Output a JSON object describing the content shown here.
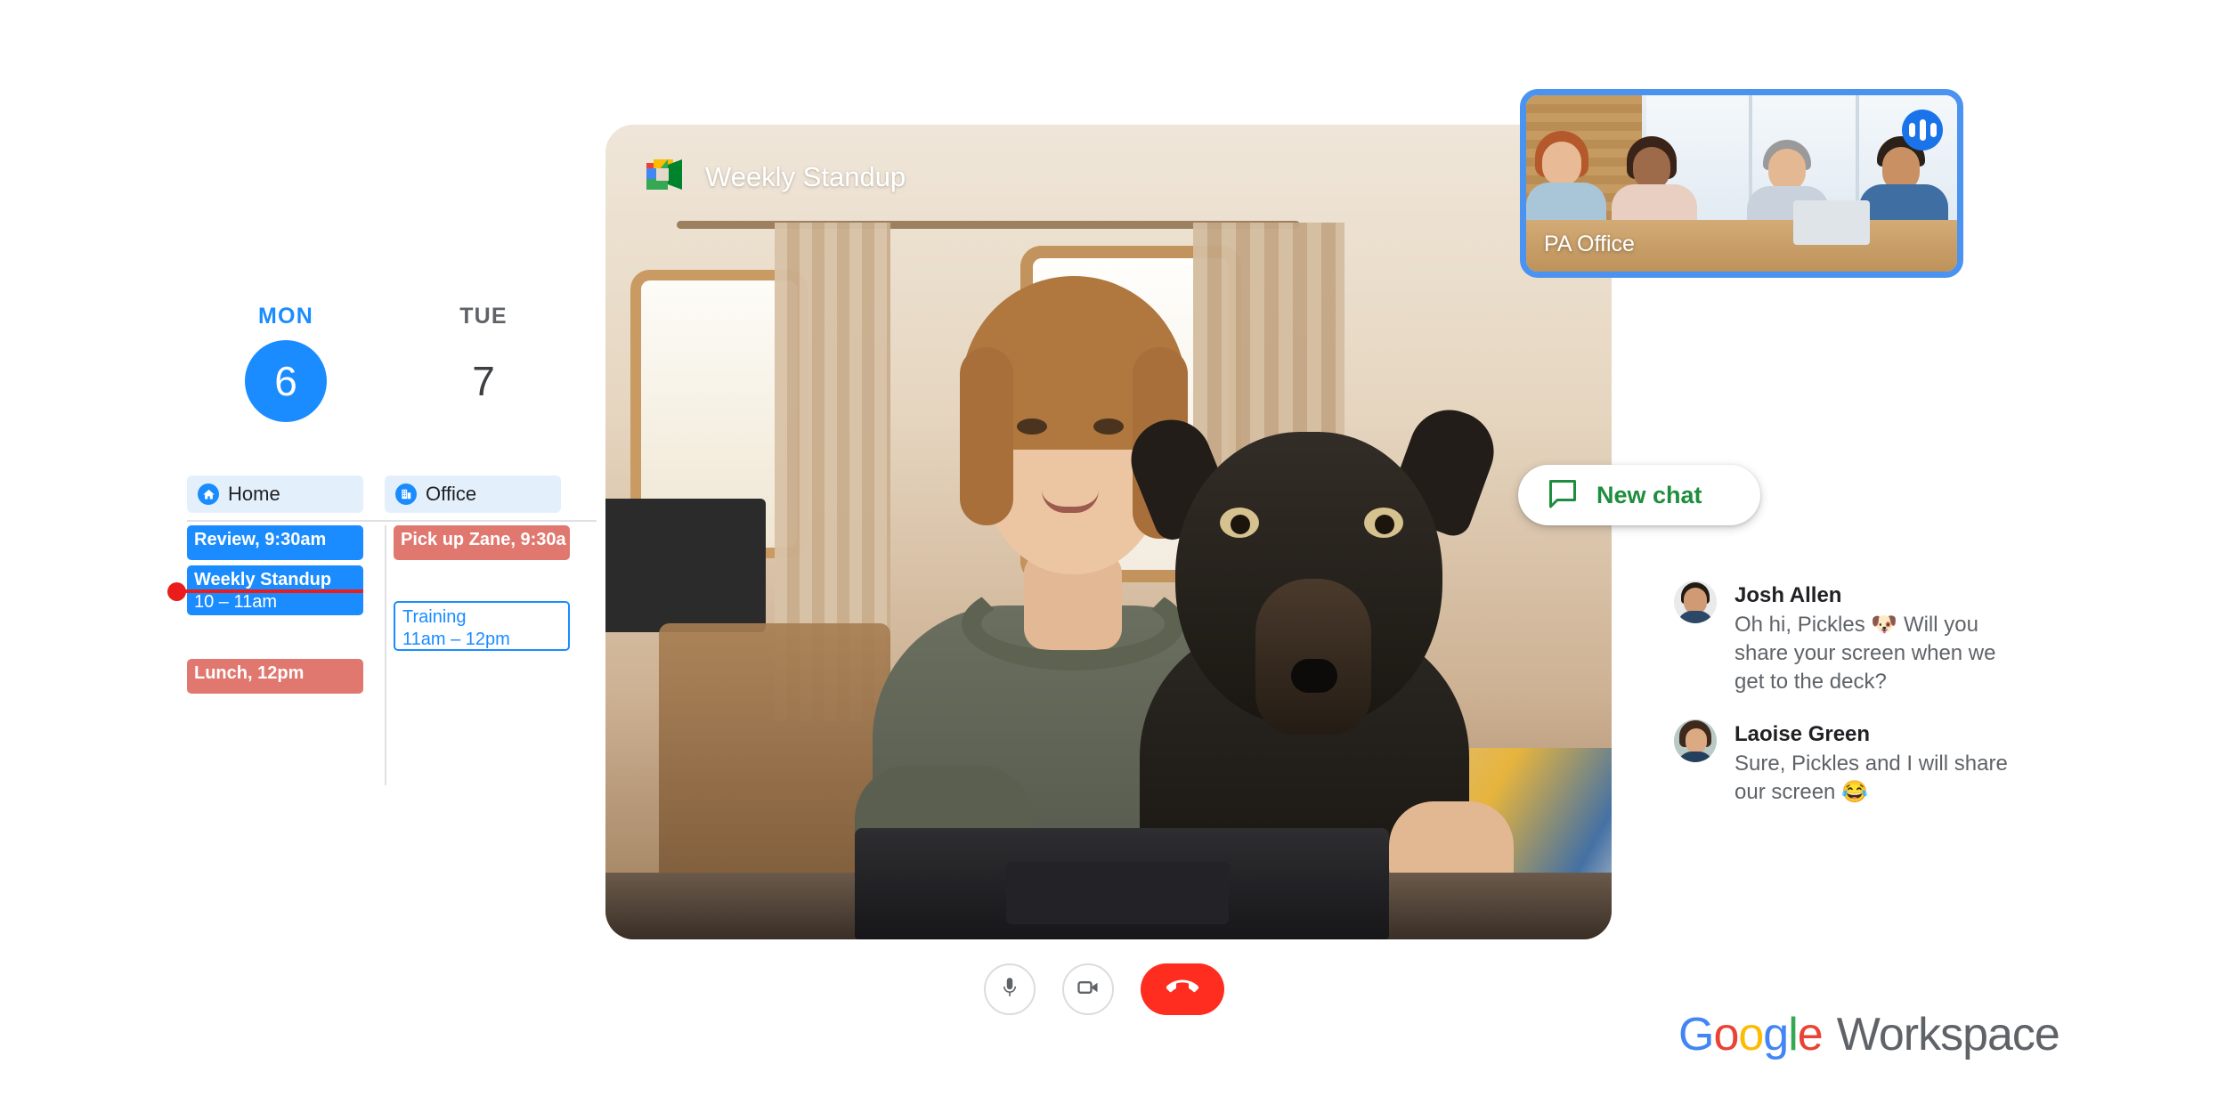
{
  "calendar": {
    "columns": [
      {
        "dow": "MON",
        "day": "6",
        "is_today": true,
        "location": {
          "label": "Home",
          "icon": "home-icon"
        }
      },
      {
        "dow": "TUE",
        "day": "7",
        "is_today": false,
        "location": {
          "label": "Office",
          "icon": "office-building-icon"
        }
      }
    ],
    "events_mon": [
      {
        "title": "Review, 9:30am",
        "style": "blue",
        "line2": ""
      },
      {
        "title": "Weekly Standup",
        "style": "blue",
        "line2": "10 – 11am"
      },
      {
        "title": "Lunch, 12pm",
        "style": "red",
        "line2": ""
      }
    ],
    "events_tue": [
      {
        "title": "Pick up Zane, 9:30a",
        "style": "red",
        "line2": ""
      },
      {
        "title": "Training",
        "style": "outline",
        "line2": "11am – 12pm"
      }
    ],
    "now_indicator": "current-time-marker"
  },
  "meeting": {
    "title": "Weekly Standup",
    "logo_icon": "google-meet-icon",
    "pip": {
      "label": "PA Office",
      "audio_icon": "audio-level-icon",
      "border_color": "#4b93f0"
    },
    "controls": [
      {
        "name": "microphone-button",
        "icon": "microphone-icon"
      },
      {
        "name": "camera-button",
        "icon": "video-camera-icon"
      },
      {
        "name": "end-call-button",
        "icon": "phone-hangup-icon"
      }
    ]
  },
  "chat": {
    "new_chat": {
      "label": "New chat",
      "icon": "chat-bubble-icon",
      "color": "#1e8e3e"
    },
    "messages": [
      {
        "name": "Josh Allen",
        "text": "Oh hi, Pickles 🐶 Will you share your screen when we get to the deck?",
        "avatar": "avatar-josh-allen"
      },
      {
        "name": "Laoise Green",
        "text": "Sure, Pickles and I will share our screen 😂",
        "avatar": "avatar-laoise-green"
      }
    ]
  },
  "branding": {
    "google": [
      "G",
      "o",
      "o",
      "g",
      "l",
      "e"
    ],
    "product": "Workspace"
  }
}
